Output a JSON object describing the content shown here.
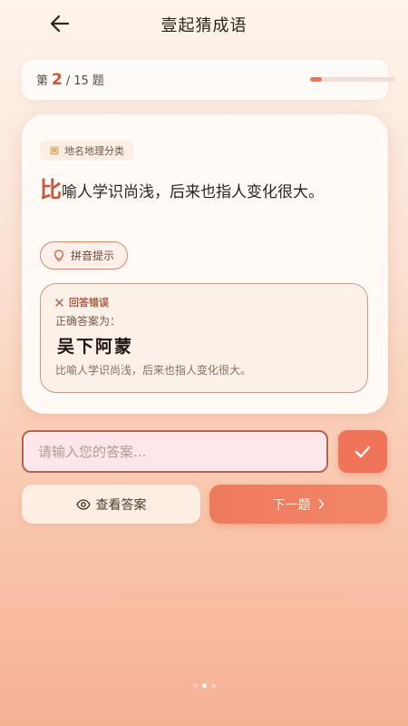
{
  "header": {
    "title": "壹起猜成语"
  },
  "progress": {
    "prefix": "第",
    "current": "2",
    "separator": "/",
    "total": "15",
    "suffix": "题",
    "fraction": 0.133
  },
  "question": {
    "category": "地名地理分类",
    "first_char": "比",
    "rest_text": "喻人学识尚浅，后来也指人变化很大。"
  },
  "hint": {
    "label": "拼音提示"
  },
  "result": {
    "status": "回答错误",
    "label": "正确答案为：",
    "answer": "吴下阿蒙",
    "meaning": "比喻人学识尚浅，后来也指人变化很大。"
  },
  "input": {
    "placeholder": "请输入您的答案...",
    "value": ""
  },
  "actions": {
    "view_answer": "查看答案",
    "next": "下一题"
  },
  "pagination": {
    "count": 3,
    "active_index": 1
  },
  "colors": {
    "accent": "#ef7459",
    "highlight": "#c4583a"
  }
}
